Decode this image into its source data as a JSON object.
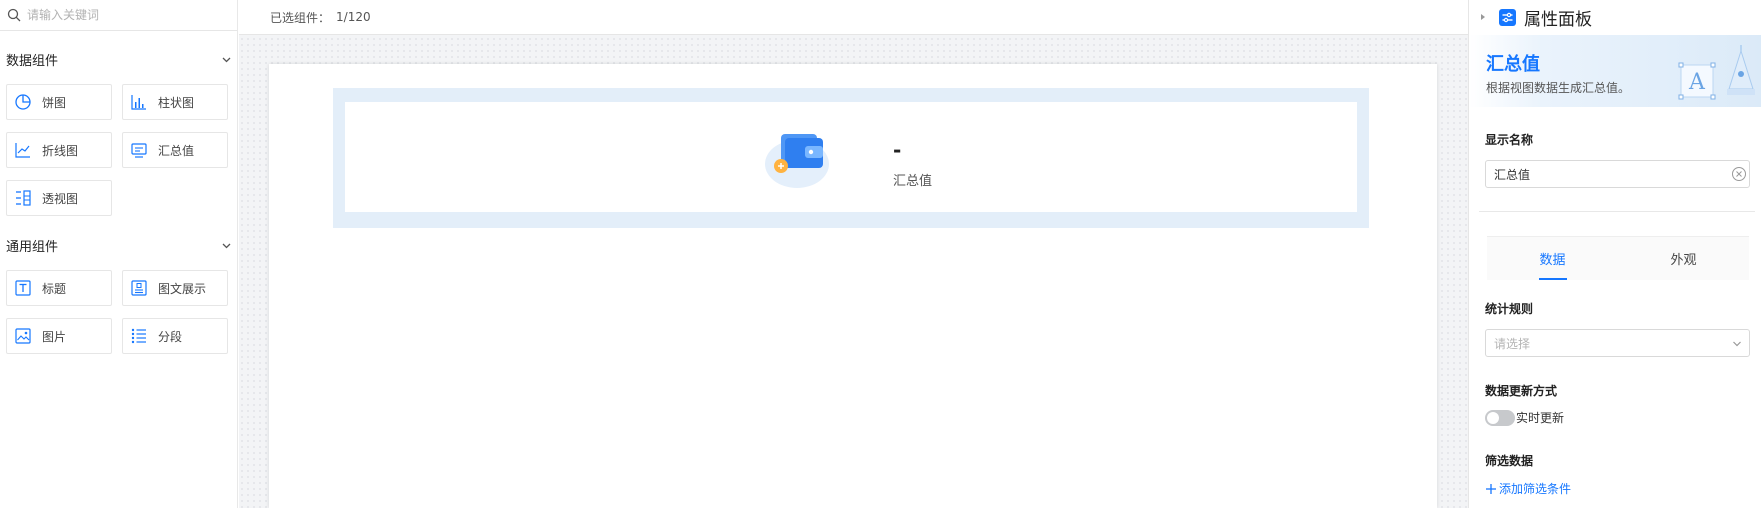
{
  "left_panel": {
    "search": {
      "placeholder": "请输入关键词"
    },
    "groups": [
      {
        "title": "数据组件",
        "items": [
          {
            "label": "饼图",
            "icon": "pie-chart-icon"
          },
          {
            "label": "柱状图",
            "icon": "bar-chart-icon"
          },
          {
            "label": "折线图",
            "icon": "line-chart-icon"
          },
          {
            "label": "汇总值",
            "icon": "summary-value-icon"
          },
          {
            "label": "透视图",
            "icon": "pivot-table-icon"
          }
        ]
      },
      {
        "title": "通用组件",
        "items": [
          {
            "label": "标题",
            "icon": "title-text-icon"
          },
          {
            "label": "图文展示",
            "icon": "image-text-icon"
          },
          {
            "label": "图片",
            "icon": "image-icon"
          },
          {
            "label": "分段",
            "icon": "list-segment-icon"
          }
        ]
      }
    ]
  },
  "center": {
    "selected_label": "已选组件：",
    "selected_count": "1/120",
    "summary_widget": {
      "value": "-",
      "label": "汇总值",
      "icon": "wallet-icon"
    }
  },
  "right_panel": {
    "title": "属性面板",
    "banner": {
      "title": "汇总值",
      "description": "根据视图数据生成汇总值。"
    },
    "display_name": {
      "label": "显示名称",
      "value": "汇总值"
    },
    "tabs": [
      {
        "label": "数据",
        "active": true
      },
      {
        "label": "外观",
        "active": false
      }
    ],
    "stat_rule": {
      "label": "统计规则",
      "placeholder": "请选择"
    },
    "update_mode": {
      "label": "数据更新方式",
      "toggle_label": "实时更新",
      "enabled": false
    },
    "filter": {
      "label": "筛选数据",
      "add_label": "添加筛选条件"
    }
  },
  "colors": {
    "accent": "#1677ff",
    "selection": "#e3eef9"
  }
}
